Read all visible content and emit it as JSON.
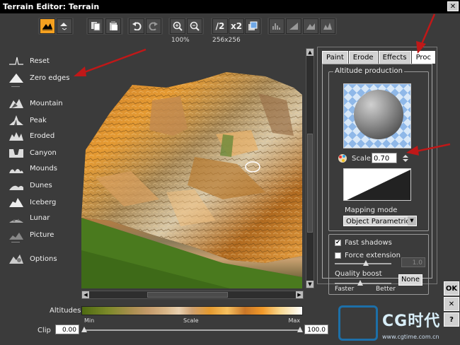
{
  "window": {
    "title": "Terrain Editor: Terrain",
    "close_glyph": "✕"
  },
  "toolbar": {
    "zoom_label": "100%",
    "resolution_label": "256x256",
    "half_label": "/2",
    "double_label": "x2"
  },
  "left_tools": [
    {
      "label": "Reset",
      "icon": "reset-icon"
    },
    {
      "label": "Zero edges",
      "icon": "zero-edges-icon"
    },
    {
      "label": "Mountain",
      "icon": "mountain-icon"
    },
    {
      "label": "Peak",
      "icon": "peak-icon"
    },
    {
      "label": "Eroded",
      "icon": "eroded-icon"
    },
    {
      "label": "Canyon",
      "icon": "canyon-icon"
    },
    {
      "label": "Mounds",
      "icon": "mounds-icon"
    },
    {
      "label": "Dunes",
      "icon": "dunes-icon"
    },
    {
      "label": "Iceberg",
      "icon": "iceberg-icon"
    },
    {
      "label": "Lunar",
      "icon": "lunar-icon"
    },
    {
      "label": "Picture",
      "icon": "picture-icon"
    },
    {
      "label": "Options",
      "icon": "options-icon"
    }
  ],
  "tabs": [
    {
      "label": "Paint"
    },
    {
      "label": "Erode"
    },
    {
      "label": "Effects"
    },
    {
      "label": "Proc",
      "active": true
    }
  ],
  "altitude_production": {
    "title": "Altitude production",
    "scale_label": "Scale",
    "scale_value": "0.70",
    "mapping_label": "Mapping mode",
    "mapping_value": "Object Parametric"
  },
  "options_group": {
    "fast_shadows_label": "Fast shadows",
    "fast_shadows_checked": true,
    "force_extension_label": "Force extension",
    "force_extension_checked": false,
    "force_extension_value": "1.0",
    "quality_label": "Quality boost",
    "faster_label": "Faster",
    "better_label": "Better",
    "none_label": "None"
  },
  "bottom": {
    "altitudes_label": "Altitudes",
    "min_label": "Min",
    "scale_label": "Scale",
    "max_label": "Max",
    "clip_label": "Clip",
    "clip_min": "0.00",
    "clip_max": "100.0"
  },
  "side_buttons": {
    "ok": "OK",
    "cancel": "✕",
    "help": "?"
  },
  "watermark": {
    "brand": "CG时代",
    "url": "www.cgtime.com.cn"
  },
  "colors": {
    "accent": "#f4a020",
    "arrow": "#c01818",
    "watermark": "#1d6fa8"
  }
}
